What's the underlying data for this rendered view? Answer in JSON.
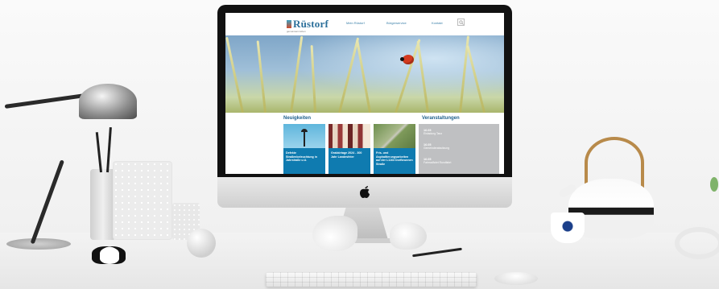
{
  "website": {
    "logo": {
      "text": "Rüstorf",
      "subtitle": "gemeinsam leben"
    },
    "nav": [
      {
        "label": "Mein Rüstorf"
      },
      {
        "label": "Bürgerservice"
      },
      {
        "label": "Kontakt"
      }
    ],
    "sections": {
      "news_title": "Neuigkeiten",
      "events_title": "Veranstaltungen"
    },
    "news": [
      {
        "title": "Defekte Straßenbeleuchtung in Jahrstraße u.U."
      },
      {
        "title": "Grabkirtage 2024 - 300 Jahr Landesfeier"
      },
      {
        "title": "Fris- und Asphaltierungsarbeiten auf der L1163 Dorfbrunnen Straße"
      }
    ],
    "events": [
      {
        "date": "16.05",
        "title": "Einladung Tanz"
      },
      {
        "date": "16.05",
        "title": "Gemeinderatssitzung"
      },
      {
        "date": "16.05",
        "title": "Fahrradfahrt Rundfahrt"
      }
    ]
  },
  "colors": {
    "brand_blue": "#1e5f8c",
    "card_blue": "#0f7bb0",
    "events_gray": "#bfc0c2"
  },
  "icons": {
    "search": "search-icon",
    "apple": "apple-logo-icon"
  }
}
